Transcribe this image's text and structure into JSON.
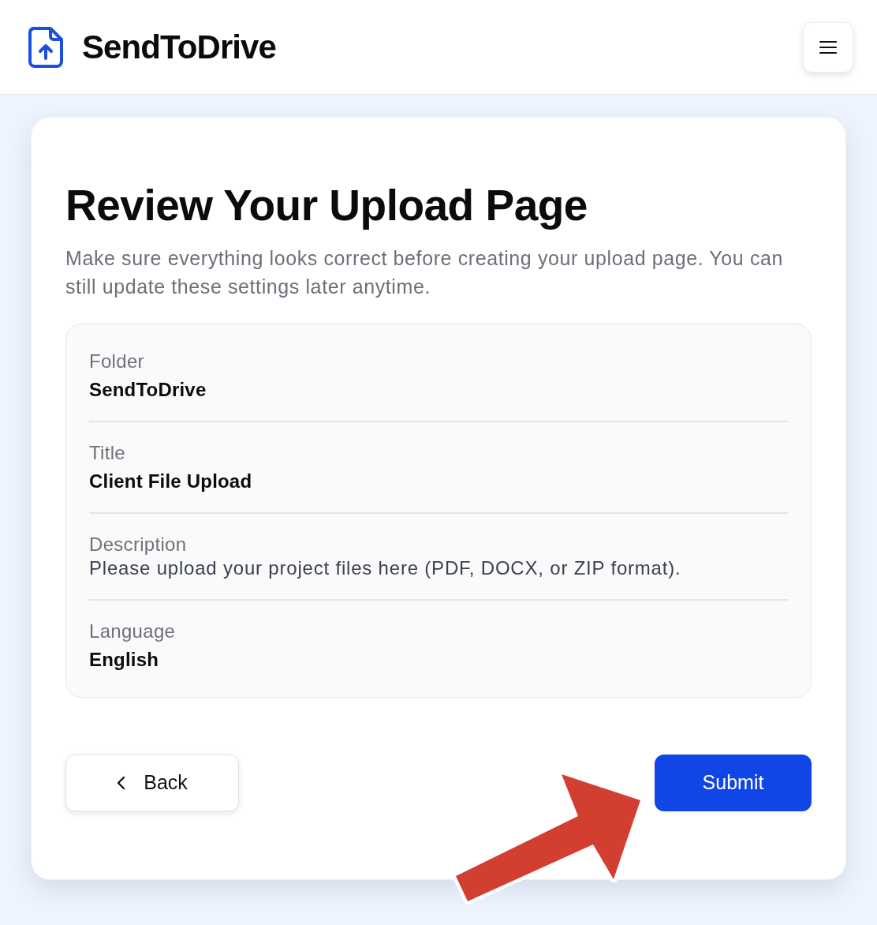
{
  "header": {
    "brand": "SendToDrive",
    "actions": [
      {
        "kind": "menu"
      }
    ]
  },
  "review": {
    "title": "Review Your Upload Page",
    "subtitle": "Make sure everything looks correct before creating your upload page. You can still update these settings later anytime.",
    "fields": [
      {
        "label": "Folder",
        "value": "SendToDrive",
        "kind": "strong"
      },
      {
        "label": "Title",
        "value": "Client File Upload",
        "kind": "strong"
      },
      {
        "label": "Description",
        "value": "Please upload your project files here (PDF, DOCX, or ZIP format).",
        "kind": "plain"
      },
      {
        "label": "Language",
        "value": "English",
        "kind": "strong"
      }
    ]
  },
  "buttons": [
    {
      "label": "Back",
      "kind": "secondary"
    },
    {
      "label": "Submit",
      "kind": "primary"
    }
  ],
  "annotations": [
    {
      "kind": "arrow"
    }
  ]
}
